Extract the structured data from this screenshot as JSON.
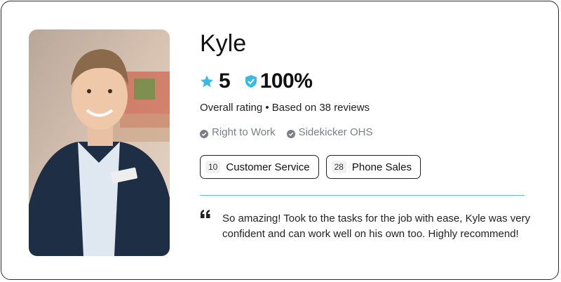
{
  "profile": {
    "name": "Kyle",
    "rating": "5",
    "reliability": "100%",
    "rating_summary": "Overall rating • Based on 38 reviews",
    "photo_alt": "Kyle",
    "credentials": [
      {
        "label": "Right to Work"
      },
      {
        "label": "Sidekicker OHS"
      }
    ],
    "skills": [
      {
        "count": "10",
        "label": "Customer Service"
      },
      {
        "count": "28",
        "label": "Phone Sales"
      }
    ],
    "review": "So amazing! Took to the tasks for the job with ease, Kyle was very confident and can work well on his own too. Highly recommend!"
  },
  "colors": {
    "accent": "#3db8e2",
    "divider": "#55c4e2",
    "credential_text": "#7a7f86",
    "border": "#2b2b2b"
  },
  "icons": {
    "rating": "star-icon",
    "reliability": "shield-check-icon",
    "credential": "check-circle-icon",
    "review": "quote-icon"
  }
}
